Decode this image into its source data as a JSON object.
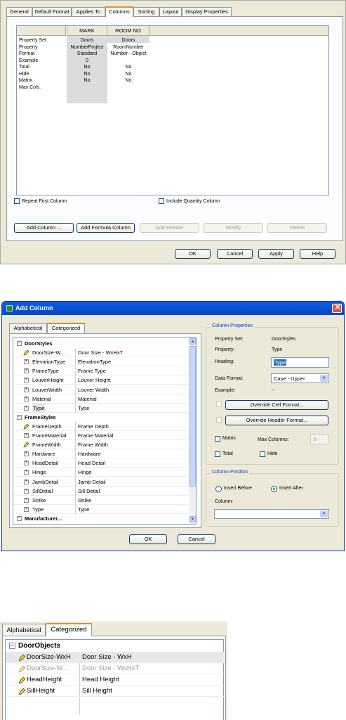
{
  "dialog1": {
    "tabs": [
      "General",
      "Default Format",
      "Applies To",
      "Columns",
      "Sorting",
      "Layout",
      "Display Properties"
    ],
    "columns": [
      "MARK",
      "ROOM NO"
    ],
    "row_labels": [
      "Property Set",
      "Property",
      "Format",
      "Example",
      "Total",
      "Hide",
      "Matrix",
      "Max Cols."
    ],
    "col1": [
      "Doors",
      "NumberProject",
      "Standard",
      "0",
      "No",
      "No",
      "No",
      ""
    ],
    "col2": [
      "Doors",
      "RoomNumber",
      "Number - Object",
      "",
      "No",
      "No",
      "No",
      ""
    ],
    "repeat_first_column": "Repeat First Column",
    "include_quantity_column": "Include Quantity Column",
    "buttons": {
      "add_column": "Add Column ...",
      "add_formula_column": "Add Formula Column",
      "add_header": "Add Header",
      "modify": "Modify",
      "delete": "Delete"
    },
    "footer": {
      "ok": "OK",
      "cancel": "Cancel",
      "apply": "Apply",
      "help": "Help"
    }
  },
  "dialog2": {
    "title": "Add Column",
    "tabs": [
      "Alphabetical",
      "Categorized"
    ],
    "groups": [
      {
        "name": "DoorStyles",
        "items": [
          {
            "name": "DoorSize-W...",
            "value": "Door Size - WxHxT",
            "icon": "pencil-icon"
          },
          {
            "name": "ElevationType",
            "value": "ElevationType",
            "icon": "expand-icon"
          },
          {
            "name": "FrameType",
            "value": "Frame Type",
            "icon": "expand-icon"
          },
          {
            "name": "LouverHeight",
            "value": "Louver Height",
            "icon": "expand-icon"
          },
          {
            "name": "LouverWidth",
            "value": "Louver Width",
            "icon": "expand-icon"
          },
          {
            "name": "Material",
            "value": "Material",
            "icon": "expand-icon"
          },
          {
            "name": "Type",
            "value": "Type",
            "icon": "expand-icon"
          }
        ]
      },
      {
        "name": "FrameStyles",
        "items": [
          {
            "name": "FrameDepth",
            "value": "Frame Depth",
            "icon": "pencil-icon"
          },
          {
            "name": "FrameMaterial",
            "value": "Frame Material",
            "icon": "expand-icon"
          },
          {
            "name": "FrameWidth",
            "value": "Frame Width",
            "icon": "pencil-icon"
          },
          {
            "name": "Hardware",
            "value": "Hardware",
            "icon": "expand-icon"
          },
          {
            "name": "HeadDetail",
            "value": "Head Detail",
            "icon": "expand-icon"
          },
          {
            "name": "Hinge",
            "value": "Hinge",
            "icon": "expand-icon"
          },
          {
            "name": "JambDetail",
            "value": "Jamb Detail",
            "icon": "expand-icon"
          },
          {
            "name": "SillDetail",
            "value": "Sill Detail",
            "icon": "expand-icon"
          },
          {
            "name": "Strike",
            "value": "Strike",
            "icon": "expand-icon"
          },
          {
            "name": "Type",
            "value": "Type",
            "icon": "expand-icon"
          }
        ]
      },
      {
        "name": "Manufacturer...",
        "items": []
      }
    ],
    "column_properties": {
      "title": "Column Properties",
      "property_set_label": "Property Set:",
      "property_set_value": "DoorStyles",
      "property_label": "Property:",
      "property_value": "Type",
      "heading_label": "Heading:",
      "heading_value": "Type",
      "data_format_label": "Data Format:",
      "data_format_value": "Case - Upper",
      "example_label": "Example:",
      "example_value": "--",
      "override_cell": "Override Cell Format...",
      "override_header": "Override Header Format...",
      "matrix": "Matrix",
      "max_columns_label": "Max Columns:",
      "max_columns_value": "3",
      "total": "Total",
      "hide": "Hide"
    },
    "column_position": {
      "title": "Column Position",
      "insert_before": "Insert Before",
      "insert_after": "Insert After",
      "column_label": "Column:"
    },
    "ok": "OK",
    "cancel": "Cancel"
  },
  "panel3": {
    "tabs": [
      "Alphabetical",
      "Categorized"
    ],
    "group": "DoorObjects",
    "items": [
      {
        "name": "DoorSize-WxH",
        "value": "Door Size - WxH"
      },
      {
        "name": "DoorSize-W...",
        "value": "Door Size - WxHxT"
      },
      {
        "name": "HeadHeight",
        "value": "Head Height"
      },
      {
        "name": "SillHeight",
        "value": "Sill Height"
      }
    ]
  }
}
